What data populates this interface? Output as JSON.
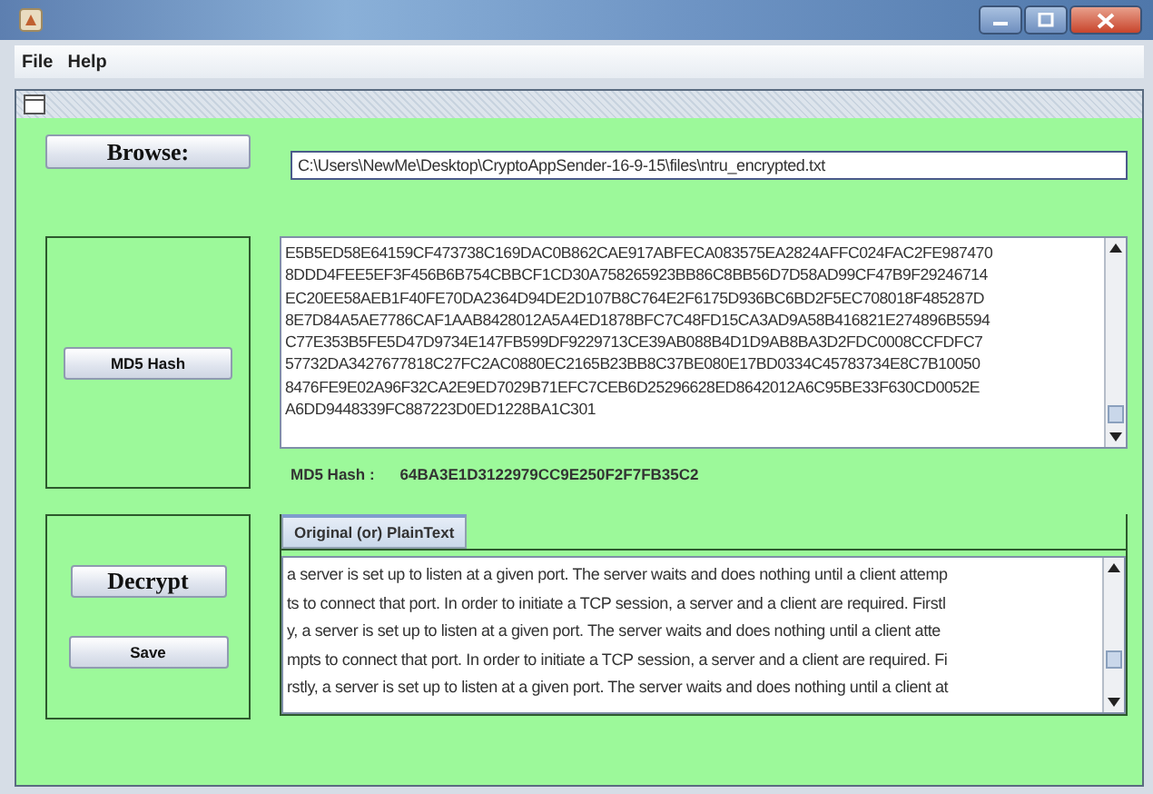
{
  "menu": [
    "File",
    "Help"
  ],
  "browse": {
    "label": "Browse:",
    "path": "C:\\Users\\NewMe\\Desktop\\CryptoAppSender-16-9-15\\files\\ntru_encrypted.txt"
  },
  "cipher_lines": [
    "E5B5ED58E64159CF473738C169DAC0B862CAE917ABFECA083575EA2824AFFC024FAC2FE987470",
    "8DDD4FEE5EF3F456B6B754CBBCF1CD30A758265923BB86C8BB56D7D58AD99CF47B9F29246714",
    "EC20EE58AEB1F40FE70DA2364D94DE2D107B8C764E2F6175D936BC6BD2F5EC708018F485287D",
    "8E7D84A5AE7786CAF1AAB8428012A5A4ED1878BFC7C48FD15CA3AD9A58B416821E274896B5594",
    "C77E353B5FE5D47D9734E147FB599DF9229713CE39AB088B4D1D9AB8BA3D2FDC0008CCFDFC7",
    "57732DA3427677818C27FC2AC0880EC2165B23BB8C37BE080E17BD0334C45783734E8C7B10050",
    "8476FE9E02A96F32CA2E9ED7029B71EFC7CEB6D25296628ED8642012A6C95BE33F630CD0052E",
    "A6DD9448339FC887223D0ED1228BA1C301"
  ],
  "md5_button": "MD5 Hash",
  "md5_label": "MD5 Hash :",
  "md5_value": "64BA3E1D3122979CC9E250F2F7FB35C2",
  "decrypt_button": "Decrypt",
  "save_button": "Save",
  "tabs": [
    {
      "label": "Original (or) PlainText",
      "selected": true
    }
  ],
  "plain_lines": [
    "a server is set up to listen at a given port. The server waits and does nothing until a client attemp",
    "ts to connect that port. In order to initiate a TCP session, a server and a client are required. Firstl",
    "y, a server is set up to listen at a given port. The server waits and does nothing until a client atte",
    "mpts to connect that port. In order to initiate a TCP session, a server and a client are required. Fi",
    "rstly, a server is set up to listen at a given port. The server waits and does nothing until a client at"
  ]
}
